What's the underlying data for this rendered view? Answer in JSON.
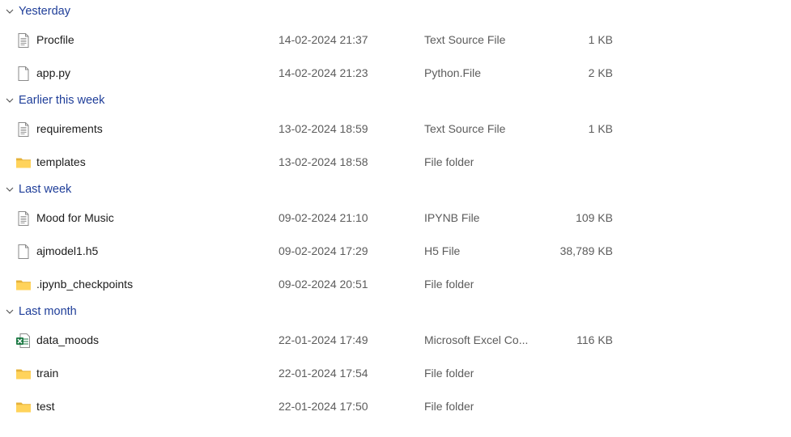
{
  "groups": [
    {
      "label": "Yesterday",
      "items": [
        {
          "name": "Procfile",
          "date": "14-02-2024 21:37",
          "type": "Text Source File",
          "size": "1 KB",
          "icon": "text-file-icon"
        },
        {
          "name": "app.py",
          "date": "14-02-2024 21:23",
          "type": "Python.File",
          "size": "2 KB",
          "icon": "blank-file-icon"
        }
      ]
    },
    {
      "label": "Earlier this week",
      "items": [
        {
          "name": "requirements",
          "date": "13-02-2024 18:59",
          "type": "Text Source File",
          "size": "1 KB",
          "icon": "text-file-icon"
        },
        {
          "name": "templates",
          "date": "13-02-2024 18:58",
          "type": "File folder",
          "size": "",
          "icon": "folder-icon"
        }
      ]
    },
    {
      "label": "Last week",
      "items": [
        {
          "name": "Mood for Music",
          "date": "09-02-2024 21:10",
          "type": "IPYNB File",
          "size": "109 KB",
          "icon": "text-file-icon"
        },
        {
          "name": "ajmodel1.h5",
          "date": "09-02-2024 17:29",
          "type": "H5 File",
          "size": "38,789 KB",
          "icon": "blank-file-icon"
        },
        {
          "name": ".ipynb_checkpoints",
          "date": "09-02-2024 20:51",
          "type": "File folder",
          "size": "",
          "icon": "folder-icon"
        }
      ]
    },
    {
      "label": "Last month",
      "items": [
        {
          "name": "data_moods",
          "date": "22-01-2024 17:49",
          "type": "Microsoft Excel Co...",
          "size": "116 KB",
          "icon": "excel-file-icon"
        },
        {
          "name": "train",
          "date": "22-01-2024 17:54",
          "type": "File folder",
          "size": "",
          "icon": "folder-icon"
        },
        {
          "name": "test",
          "date": "22-01-2024 17:50",
          "type": "File folder",
          "size": "",
          "icon": "folder-icon"
        }
      ]
    }
  ]
}
